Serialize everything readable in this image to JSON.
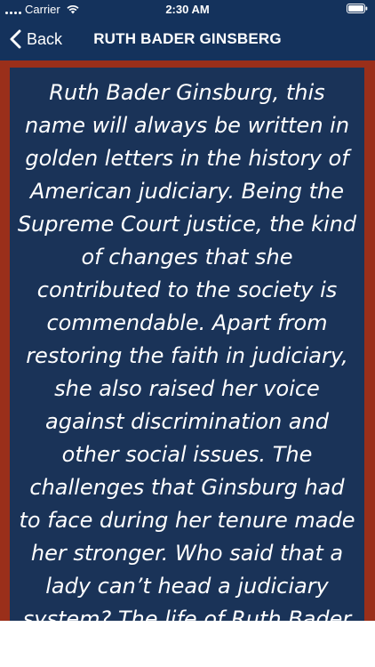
{
  "status_bar": {
    "carrier": "Carrier",
    "time": "2:30 AM"
  },
  "nav": {
    "back_label": "Back",
    "title": "RUTH BADER GINSBERG"
  },
  "article": {
    "text": "Ruth Bader Ginsburg, this name will always be written in golden letters in the history of American judiciary. Being the Supreme Court justice, the kind of changes that she contributed to the society is commendable. Apart from restoring the faith in judiciary, she also raised her voice against discrimination and other social issues. The challenges that Ginsburg had to face during her tenure made her stronger. Who said that a lady can’t head a judiciary system? The life of Ruth Bader"
  },
  "colors": {
    "nav_background": "#14325c",
    "frame_border": "#9a2f1a",
    "panel_background": "#1a3358",
    "text": "#ffffff"
  },
  "icons": {
    "signal": "signal-dots-icon",
    "wifi": "wifi-icon",
    "battery": "battery-icon",
    "back": "chevron-left-icon"
  }
}
